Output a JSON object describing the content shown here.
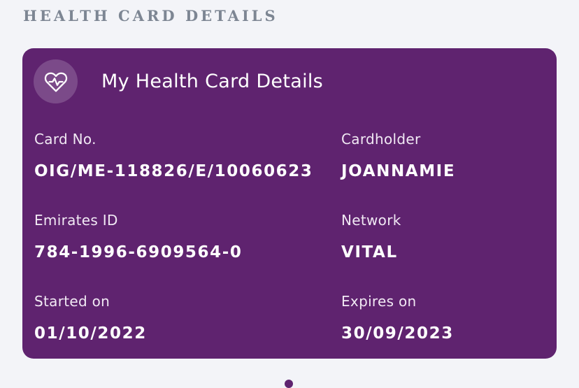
{
  "section": {
    "title": "HEALTH CARD DETAILS"
  },
  "card": {
    "title": "My Health Card Details",
    "icon": "heart-pulse-icon",
    "background_color": "#5f236f",
    "fields": {
      "card_no": {
        "label": "Card No.",
        "value": "OIG/ME-118826/E/10060623"
      },
      "cardholder": {
        "label": "Cardholder",
        "value": "JOANNAMIE"
      },
      "emirates_id": {
        "label": "Emirates ID",
        "value": "784-1996-6909564-0"
      },
      "network": {
        "label": "Network",
        "value": "VITAL"
      },
      "started_on": {
        "label": "Started on",
        "value": "01/10/2022"
      },
      "expires_on": {
        "label": "Expires on",
        "value": "30/09/2023"
      }
    }
  }
}
